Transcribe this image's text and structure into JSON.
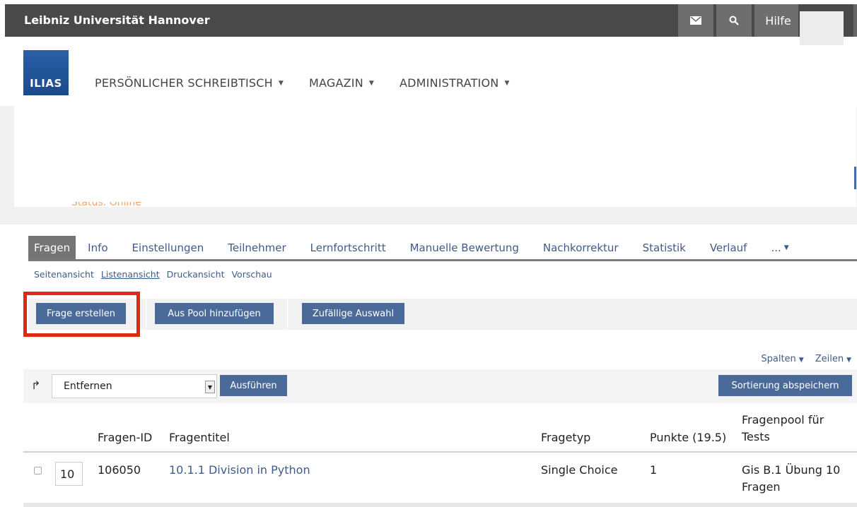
{
  "topbar": {
    "site_title": "Leibniz Universität Hannover",
    "mail_icon": "envelope-icon",
    "search_icon": "magnifier-icon",
    "help_label": "Hilfe"
  },
  "logo": {
    "text": "ILIAS"
  },
  "mainnav": {
    "items": [
      {
        "label": "PERSÖNLICHER SCHREIBTISCH"
      },
      {
        "label": "MAGAZIN"
      },
      {
        "label": "ADMINISTRATION"
      }
    ]
  },
  "object": {
    "status": "Status: Online"
  },
  "tabs": {
    "items": [
      {
        "label": "Fragen"
      },
      {
        "label": "Info"
      },
      {
        "label": "Einstellungen"
      },
      {
        "label": "Teilnehmer"
      },
      {
        "label": "Lernfortschritt"
      },
      {
        "label": "Manuelle Bewertung"
      },
      {
        "label": "Nachkorrektur"
      },
      {
        "label": "Statistik"
      },
      {
        "label": "Verlauf"
      },
      {
        "label": "..."
      }
    ]
  },
  "subtabs": {
    "items": [
      {
        "label": "Seitenansicht"
      },
      {
        "label": "Listenansicht"
      },
      {
        "label": "Druckansicht"
      },
      {
        "label": "Vorschau"
      }
    ]
  },
  "toolbar": {
    "create_label": "Frage erstellen",
    "pool_label": "Aus Pool hinzufügen",
    "random_label": "Zufällige Auswahl"
  },
  "table_controls": {
    "columns_label": "Spalten",
    "rows_label": "Zeilen",
    "command_selected": "Entfernen",
    "execute_label": "Ausführen",
    "save_sort_label": "Sortierung abspeichern"
  },
  "table": {
    "headers": {
      "id": "Fragen-ID",
      "title": "Fragentitel",
      "type": "Fragetyp",
      "points": "Punkte (19.5)",
      "pool_line1": "Fragenpool für",
      "pool_line2": "Tests"
    },
    "rows": [
      {
        "position": "10",
        "id": "106050",
        "title": "10.1.1 Division in Python",
        "type": "Single Choice",
        "points": "1",
        "pool_line1": "Gis B.1 Übung 10",
        "pool_line2": "Fragen"
      }
    ]
  },
  "colors": {
    "topbar": "#494949",
    "button": "#4a6b99",
    "link": "#3f5c88",
    "highlight": "#e1290f",
    "status": "#f2a46c"
  }
}
